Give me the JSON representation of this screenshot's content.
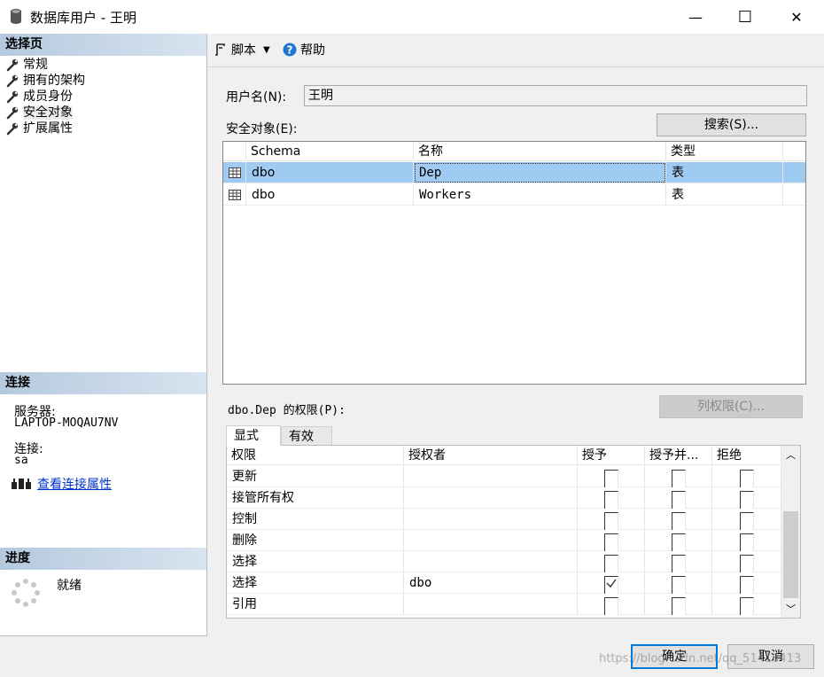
{
  "window": {
    "title": "数据库用户 - 王明",
    "controls": {
      "minimize": "—",
      "maximize": "☐",
      "close": "✕"
    }
  },
  "left": {
    "select_page_header": "选择页",
    "pages": [
      {
        "label": "常规",
        "icon": "wrench-icon"
      },
      {
        "label": "拥有的架构",
        "icon": "wrench-icon"
      },
      {
        "label": "成员身份",
        "icon": "wrench-icon"
      },
      {
        "label": "安全对象",
        "icon": "wrench-icon",
        "selected": true
      },
      {
        "label": "扩展属性",
        "icon": "wrench-icon"
      }
    ],
    "connection_header": "连接",
    "server_label": "服务器:",
    "server_value": "LAPTOP-MOQAU7NV",
    "connection_label": "连接:",
    "connection_value": "sa",
    "view_link": "查看连接属性",
    "progress_header": "进度",
    "progress_status": "就绪"
  },
  "toolbar": {
    "script_label": "脚本",
    "help_label": "帮助"
  },
  "main": {
    "username_label": "用户名(N):",
    "username_value": "王明",
    "securables_label": "安全对象(E):",
    "search_button": "搜索(S)...",
    "securables_columns": [
      "Schema",
      "名称",
      "类型"
    ],
    "securables_rows": [
      {
        "schema": "dbo",
        "name": "Dep",
        "type": "表",
        "selected": true
      },
      {
        "schema": "dbo",
        "name": "Workers",
        "type": "表"
      }
    ],
    "permissions_label": "dbo.Dep 的权限(P):",
    "column_perms_button": "列权限(C)...",
    "tabs": [
      "显式",
      "有效"
    ],
    "perm_columns": [
      "权限",
      "授权者",
      "授予",
      "授予并...",
      "拒绝"
    ],
    "perm_rows": [
      {
        "permission": "更新",
        "grantor": "",
        "grant": false,
        "with_grant": false,
        "deny": false
      },
      {
        "permission": "接管所有权",
        "grantor": "",
        "grant": false,
        "with_grant": false,
        "deny": false
      },
      {
        "permission": "控制",
        "grantor": "",
        "grant": false,
        "with_grant": false,
        "deny": false
      },
      {
        "permission": "删除",
        "grantor": "",
        "grant": false,
        "with_grant": false,
        "deny": false
      },
      {
        "permission": "选择",
        "grantor": "",
        "grant": false,
        "with_grant": false,
        "deny": false
      },
      {
        "permission": "选择",
        "grantor": "dbo",
        "grant": true,
        "with_grant": false,
        "deny": false
      },
      {
        "permission": "引用",
        "grantor": "",
        "grant": false,
        "with_grant": false,
        "deny": false
      }
    ]
  },
  "footer": {
    "ok_button": "确定",
    "cancel_button": "取消",
    "watermark": "https://blog.csdn.net/qq_51416413"
  }
}
